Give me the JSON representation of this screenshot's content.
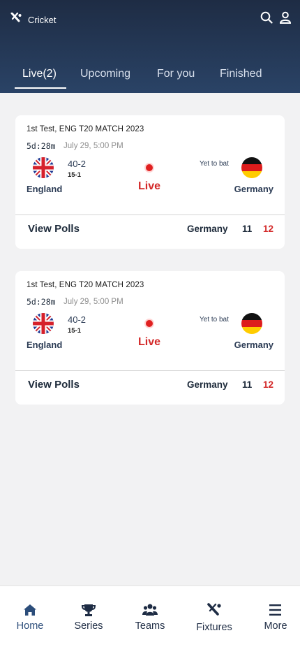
{
  "app": {
    "title": "Cricket",
    "logo_icon": "cricket-bat-icon"
  },
  "header_icons": [
    "search-icon",
    "user-icon"
  ],
  "tabs": [
    {
      "label": "Live(2)",
      "active": true
    },
    {
      "label": "Upcoming",
      "active": false
    },
    {
      "label": "For you",
      "active": false
    },
    {
      "label": "Finished",
      "active": false
    }
  ],
  "matches": [
    {
      "title": "1st Test,  ENG T20 MATCH 2023",
      "countdown": "5d:28m",
      "date": "July 29, 5:00 PM",
      "team_left": "England",
      "score": "40-2",
      "overs": "15-1",
      "status": "Live",
      "team_right_status": "Yet to bat",
      "team_right": "Germany",
      "polls_label": "View Polls",
      "poll_team": "Germany",
      "poll_value_a": "11",
      "poll_value_b": "12"
    },
    {
      "title": "1st Test,  ENG T20 MATCH 2023",
      "countdown": "5d:28m",
      "date": "July 29, 5:00 PM",
      "team_left": "England",
      "score": "40-2",
      "overs": "15-1",
      "status": "Live",
      "team_right_status": "Yet to bat",
      "team_right": "Germany",
      "polls_label": "View Polls",
      "poll_team": "Germany",
      "poll_value_a": "11",
      "poll_value_b": "12"
    }
  ],
  "bottom_nav": [
    {
      "label": "Home",
      "icon": "home-icon",
      "active": true
    },
    {
      "label": "Series",
      "icon": "trophy-icon",
      "active": false
    },
    {
      "label": "Teams",
      "icon": "teams-icon",
      "active": false
    },
    {
      "label": "Fixtures",
      "icon": "cricket-bat-icon",
      "active": false
    },
    {
      "label": "More",
      "icon": "menu-icon",
      "active": false
    }
  ],
  "colors": {
    "header": "#1e2c44",
    "live_red": "#d32828",
    "text_dark": "#1d2a3a"
  }
}
